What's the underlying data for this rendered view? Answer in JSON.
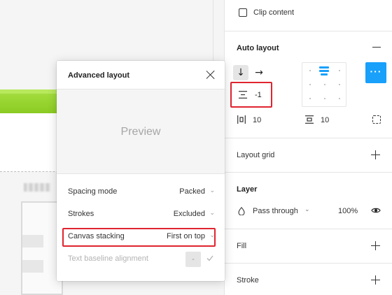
{
  "panel": {
    "clip_content_label": "Clip content",
    "auto_layout": {
      "title": "Auto layout",
      "direction_vertical": "↓",
      "direction_horizontal": "→",
      "more_label": "···",
      "spacing_value": "-1",
      "padding_horizontal": "10",
      "padding_vertical": "10"
    },
    "layout_grid_title": "Layout grid",
    "layer": {
      "title": "Layer",
      "blend_mode": "Pass through",
      "opacity": "100%"
    },
    "fill_title": "Fill",
    "stroke_title": "Stroke"
  },
  "popup": {
    "title": "Advanced layout",
    "preview_label": "Preview",
    "options": [
      {
        "label": "Spacing mode",
        "value": "Packed"
      },
      {
        "label": "Strokes",
        "value": "Excluded"
      },
      {
        "label": "Canvas stacking",
        "value": "First on top"
      },
      {
        "label": "Text baseline alignment",
        "value": "-"
      }
    ]
  },
  "colors": {
    "accent": "#18a0fb",
    "highlight": "#e0242f",
    "canvas_green": "#8bcb22"
  }
}
